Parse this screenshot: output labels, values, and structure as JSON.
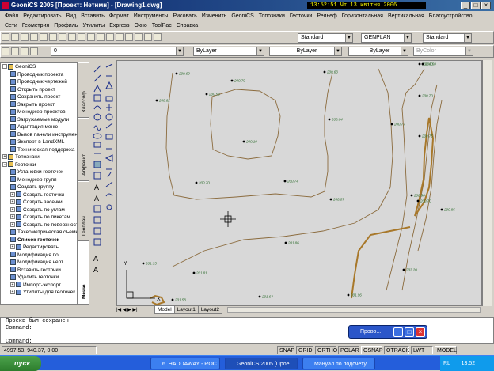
{
  "window": {
    "title": "GeoniCS 2005 [Проект: Нетнмн] - [Drawing1.dwg]",
    "clock": "13:52:51  Чт 13 квітня 2006"
  },
  "menu_row1": [
    "Файл",
    "Редактировать",
    "Вид",
    "Вставить",
    "Формат",
    "Инструменты",
    "Рисовать",
    "Изменить",
    "GeoniCS",
    "Топознаки",
    "Геоточки",
    "Рельеф",
    "Горизонтальная",
    "Вертикальная",
    "Благоустройство"
  ],
  "menu_row2": [
    "Сети",
    "Геометрия",
    "Профиль",
    "Утилиты",
    "Express",
    "Окно",
    "ToolPac",
    "Справка"
  ],
  "toolbar": {
    "text_style": "Standard",
    "dim_style": "GENPLAN",
    "table_style": "Standard",
    "layer": "0",
    "color": "ByLayer",
    "linetype": "ByLayer",
    "lineweight": "ByLayer",
    "plotstyle": "ByColor"
  },
  "tree": {
    "items": [
      {
        "label": "GeoniCS",
        "level": 0,
        "exp": "-"
      },
      {
        "label": "Проводник проекта",
        "level": 1
      },
      {
        "label": "Проводник чертежей",
        "level": 1
      },
      {
        "label": "Открыть проект",
        "level": 1
      },
      {
        "label": "Сохранить проект",
        "level": 1
      },
      {
        "label": "Закрыть проект",
        "level": 1
      },
      {
        "label": "Менеджер проектов",
        "level": 1
      },
      {
        "label": "Загружаемые модули",
        "level": 1
      },
      {
        "label": "Адаптация меню",
        "level": 1
      },
      {
        "label": "Вызов панели инструментов",
        "level": 1
      },
      {
        "label": "Экспорт в LandXML",
        "level": 1
      },
      {
        "label": "Техническая поддержка",
        "level": 1
      },
      {
        "label": "Топознаки",
        "level": 0,
        "exp": "+"
      },
      {
        "label": "Геоточки",
        "level": 0,
        "exp": "-"
      },
      {
        "label": "Установки геоточек",
        "level": 1
      },
      {
        "label": "Менеджер групп",
        "level": 1
      },
      {
        "label": "Создать группу",
        "level": 1
      },
      {
        "label": "Создать геоточки",
        "level": 1,
        "exp": "+"
      },
      {
        "label": "Создать засечки",
        "level": 1,
        "exp": "+"
      },
      {
        "label": "Создать по углам",
        "level": 1,
        "exp": "+"
      },
      {
        "label": "Создать по пикетам",
        "level": 1,
        "exp": "+"
      },
      {
        "label": "Создать по поверхности",
        "level": 1,
        "exp": "+"
      },
      {
        "label": "Тахеометрическая съемка",
        "level": 1
      },
      {
        "label": "Список геоточек",
        "level": 1,
        "bold": true
      },
      {
        "label": "Редактировать",
        "level": 1,
        "exp": "+"
      },
      {
        "label": "Модификация по",
        "level": 1
      },
      {
        "label": "Модификация черт",
        "level": 1
      },
      {
        "label": "Вставить геоточки",
        "level": 1
      },
      {
        "label": "Удалить геоточки",
        "level": 1
      },
      {
        "label": "Импорт-экспорт",
        "level": 1,
        "exp": "+"
      },
      {
        "label": "Утилиты для геоточек",
        "level": 1,
        "exp": "+"
      }
    ]
  },
  "vtabs": [
    "Классиф",
    "Алфавит",
    "Геоплан",
    "Меню"
  ],
  "points": [
    "200.60",
    "200.62",
    "200.70",
    "200.53",
    "200.63",
    "200.84",
    "200.10",
    "200.70",
    "200.74",
    "200.07",
    "201.86",
    "201.35",
    "201.81",
    "201.58",
    "201.64",
    "201.96",
    "200.40",
    "200.77",
    "200.75",
    "200.90",
    "200.70",
    "203.20",
    "200.85",
    "200.70",
    "200.60"
  ],
  "layout_tabs": [
    "Model",
    "Layout1",
    "Layout2"
  ],
  "command_lines": [
    "Проекв был сохранен",
    "Command:",
    "Command:"
  ],
  "float_panel": {
    "title": "Прово..."
  },
  "coords": "4997.53, 940.37, 0.00",
  "status_buttons": [
    "SNAP",
    "GRID",
    "ORTHO",
    "POLAR",
    "OSNAP",
    "OTRACK",
    "LWT",
    "MODEL"
  ],
  "taskbar": {
    "start": "пуск",
    "tasks": [
      "6. HADDAWAY - ROC...",
      "GeoniCS 2005 [Прое...",
      "Мануал по подсчёту..."
    ],
    "lang": "RL",
    "time": "13:52"
  }
}
